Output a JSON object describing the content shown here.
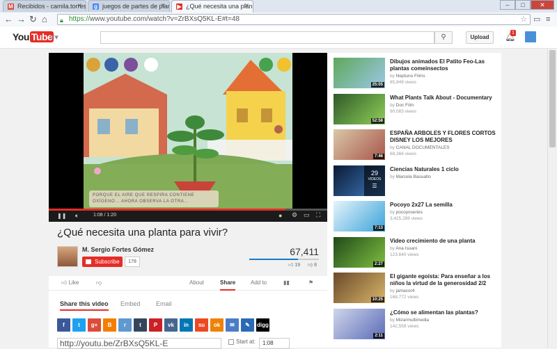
{
  "browser": {
    "tabs": [
      {
        "label": "Recibidos - camila.torres",
        "favicon": "M",
        "color": "#d44638"
      },
      {
        "label": "juegos de partes de planta",
        "favicon": "g",
        "color": "#4a8af4"
      },
      {
        "label": "¿Qué necesita una plan",
        "favicon": "▶",
        "color": "#e52d27"
      }
    ],
    "url_scheme": "https://",
    "url_rest": "www.youtube.com/watch?v=ZrBXsQ5KL-E#t=48"
  },
  "header": {
    "logo_you": "You",
    "logo_tube": "Tube",
    "upload_label": "Upload",
    "notifications": "1"
  },
  "player": {
    "caption": "PORQUE EL AIRE QUE RESPIRA CONTIENE OXÍGENO... AHORA OBSERVA LA OTRA...",
    "time": "1:08 / 1:20",
    "progress": 0.85
  },
  "video": {
    "title": "¿Qué necesita una planta para vivir?",
    "channel": "M. Sergio Fortes Gómez",
    "subscribe_label": "Subscribe",
    "subscriber_count": "178",
    "views": "67,411",
    "likes": "19",
    "dislikes": "8",
    "like_fraction": 0.7
  },
  "actions": {
    "like_label": "Like",
    "about": "About",
    "share": "Share",
    "add_to": "Add to"
  },
  "share": {
    "tab_share": "Share this video",
    "tab_embed": "Embed",
    "tab_email": "Email",
    "url": "http://youtu.be/ZrBXsQ5KL-E",
    "start_at_label": "Start at:",
    "start_time": "1:08",
    "networks": [
      {
        "label": "f",
        "color": "#3b5998",
        "icon": "facebook-icon"
      },
      {
        "label": "t",
        "color": "#1da1f2",
        "icon": "twitter-icon"
      },
      {
        "label": "g+",
        "color": "#dd4b39",
        "icon": "googleplus-icon"
      },
      {
        "label": "B",
        "color": "#f57d00",
        "icon": "blogger-icon"
      },
      {
        "label": "r",
        "color": "#5f99cf",
        "icon": "reddit-icon"
      },
      {
        "label": "t",
        "color": "#35465c",
        "icon": "tumblr-icon"
      },
      {
        "label": "P",
        "color": "#cb2027",
        "icon": "pinterest-icon"
      },
      {
        "label": "vk",
        "color": "#45668e",
        "icon": "vk-icon"
      },
      {
        "label": "in",
        "color": "#0077b5",
        "icon": "linkedin-icon"
      },
      {
        "label": "su",
        "color": "#eb4924",
        "icon": "stumbleupon-icon"
      },
      {
        "label": "ok",
        "color": "#ee8208",
        "icon": "odnoklassniki-icon"
      },
      {
        "label": "✉",
        "color": "#4a7cc7",
        "icon": "email-icon"
      },
      {
        "label": "✎",
        "color": "#2a6ab6",
        "icon": "myspace-icon"
      },
      {
        "label": "digg",
        "color": "#000000",
        "icon": "digg-icon"
      }
    ]
  },
  "recommendations": [
    {
      "title": "Dibujos animados El Patito Feo-Las plantas comeinsectos",
      "by": "Neptuno Films",
      "views": "85,949 views",
      "duration": "25:05",
      "color1": "#5ea85a",
      "color2": "#9bc8e6"
    },
    {
      "title": "What Plants Talk About - Documentary",
      "by": "Doc Film",
      "views": "90,083 views",
      "duration": "52:58",
      "color1": "#2f5a2a",
      "color2": "#8fcf57"
    },
    {
      "title": "ESPAÑA ARBOLES Y FLORES CORTOS DISNEY LOS MEJORES",
      "by": "CANAL DOCUMENTALES",
      "views": "68,366 views",
      "duration": "7:46",
      "color1": "#d9c8a8",
      "color2": "#a9554a"
    },
    {
      "title": "Ciencias Naturales 1 ciclo",
      "by": "Marcela Basualto",
      "views": "",
      "duration": "",
      "playlist_count": "29",
      "playlist_label": "VIDEOS",
      "color1": "#0b1a33",
      "color2": "#3f7cc4"
    },
    {
      "title": "Pocoyo 2x27 La semilla",
      "by": "pocoyoseries",
      "views": "3,425,289 views",
      "duration": "7:13",
      "color1": "#e6f4fb",
      "color2": "#3aa3d9"
    },
    {
      "title": "Video crecimiento de una planta",
      "by": "Ana Isuani",
      "views": "123,640 views",
      "duration": "2:27",
      "color1": "#1f4a1a",
      "color2": "#7fbf3f"
    },
    {
      "title": "El gigante egoísta: Para enseñar a los niños la virtud de la generosidad 2/2",
      "by": "jamacor4",
      "views": "168,772 views",
      "duration": "10:25",
      "color1": "#6a4a2a",
      "color2": "#d9b56a"
    },
    {
      "title": "¿Cómo se alimentan las plantas?",
      "by": "Mizarmultimedia",
      "views": "142,559 views",
      "duration": "2:11",
      "color1": "#cfd6ea",
      "color2": "#5b6bb9"
    }
  ]
}
